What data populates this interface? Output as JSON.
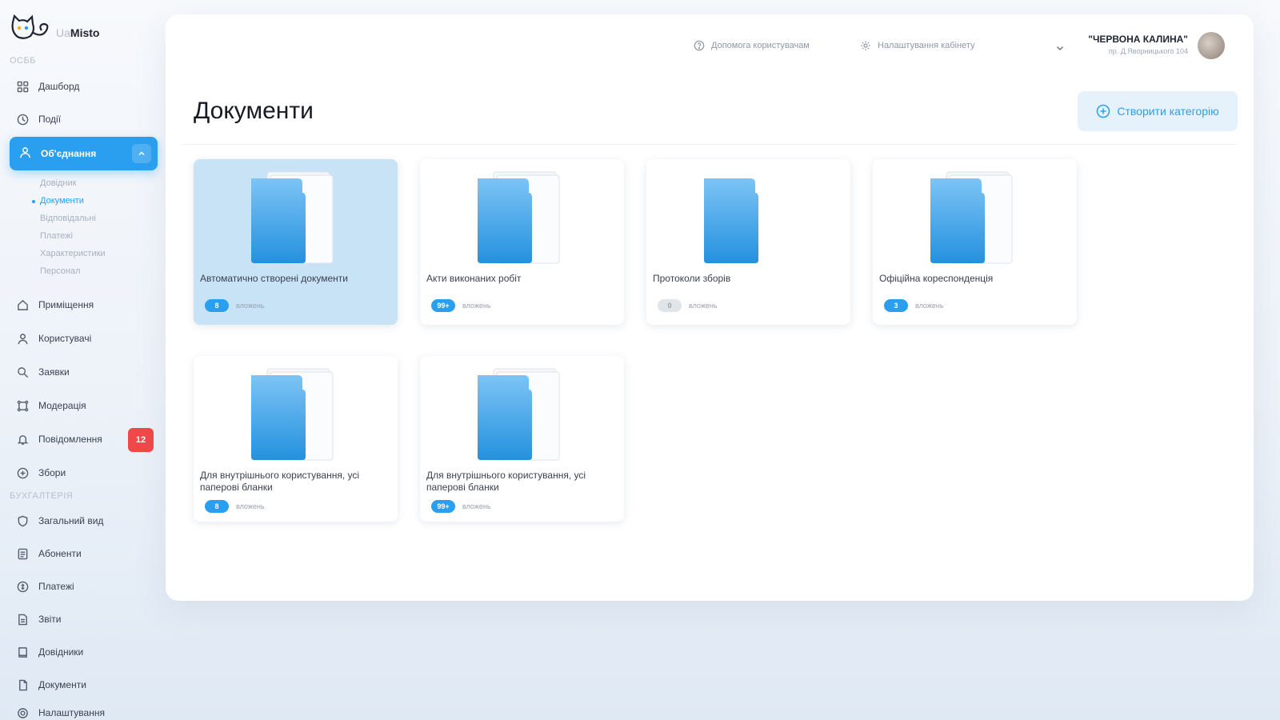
{
  "brand": {
    "prefix": "Ua",
    "name": "Misto"
  },
  "sidebar": {
    "section_main": "ОСББ",
    "section_accounting": "БУХГАЛТЕРІЯ",
    "items_top": [
      {
        "label": "Дашборд",
        "icon": "grid-icon"
      },
      {
        "label": "Події",
        "icon": "clock-icon"
      }
    ],
    "active": {
      "label": "Об'єднання",
      "icon": "users-icon"
    },
    "subitems": [
      "Довідник",
      "Документи",
      "Відповідальні",
      "Платежі",
      "Характеристики",
      "Персонал"
    ],
    "active_subitem_index": 1,
    "items_mid": [
      {
        "label": "Приміщення",
        "icon": "home-icon"
      },
      {
        "label": "Користувачі",
        "icon": "user-icon"
      },
      {
        "label": "Заявки",
        "icon": "request-icon"
      },
      {
        "label": "Модерація",
        "icon": "moderation-icon"
      },
      {
        "label": "Повідомлення",
        "icon": "bell-icon"
      },
      {
        "label": "Збори",
        "icon": "meeting-icon"
      }
    ],
    "notifications_badge": "12",
    "items_accounting": [
      {
        "label": "Загальний вид",
        "icon": "shield-icon"
      },
      {
        "label": "Абоненти",
        "icon": "subscriber-icon"
      },
      {
        "label": "Платежі",
        "icon": "coin-icon"
      },
      {
        "label": "Звіти",
        "icon": "report-icon"
      },
      {
        "label": "Довідники",
        "icon": "book-icon"
      },
      {
        "label": "Документи",
        "icon": "document-icon"
      },
      {
        "label": "Налаштування",
        "icon": "settings-icon"
      }
    ]
  },
  "header": {
    "help_label": "Допомога користувачам",
    "settings_label": "Налаштування кабінету",
    "user_name": "\"ЧЕРВОНА КАЛИНА\"",
    "user_sub": "пр. Д.Яворницького 104",
    "page_title": "Документи",
    "create_button": "Створити категорію"
  },
  "cards": [
    {
      "name": "Автоматично створені документи",
      "count": "8",
      "count_label": "вложень",
      "selected": true,
      "empty": false
    },
    {
      "name": "Акти виконаних робіт",
      "count": "99+",
      "count_label": "вложень",
      "selected": false,
      "empty": false
    },
    {
      "name": "Протоколи зборів",
      "count": "0",
      "count_label": "вложень",
      "selected": false,
      "empty": true
    },
    {
      "name": "Офіційна кореспонденція",
      "count": "3",
      "count_label": "вложень",
      "selected": false,
      "empty": false
    },
    {
      "name": "Для внутрішнього користування, усі паперові бланки",
      "count": "8",
      "count_label": "вложень",
      "selected": false,
      "empty": false
    },
    {
      "name": "Для внутрішнього користування, усі паперові бланки",
      "count": "99+",
      "count_label": "вложень",
      "selected": false,
      "empty": false
    }
  ],
  "colors": {
    "accent": "#2a9ff0",
    "danger": "#f04848",
    "selected_card": "#c8e2f6"
  }
}
